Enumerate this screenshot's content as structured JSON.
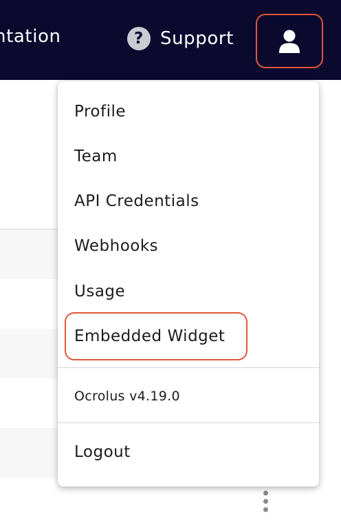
{
  "header": {
    "nav_partial_label": "ntation",
    "support_label": "Support",
    "support_icon": "question-circle-icon",
    "user_icon": "user-icon",
    "background_color": "#0b0a2e",
    "highlight_color": "#e0563a"
  },
  "user_menu": {
    "items": [
      {
        "label": "Profile"
      },
      {
        "label": "Team"
      },
      {
        "label": "API Credentials"
      },
      {
        "label": "Webhooks"
      },
      {
        "label": "Usage"
      },
      {
        "label": "Embedded Widget"
      }
    ],
    "highlighted_item": "Embedded Widget",
    "version_text": "Ocrolus v4.19.0",
    "logout_label": "Logout"
  },
  "background": {
    "row_menu_icon": "kebab-vertical-icon"
  }
}
